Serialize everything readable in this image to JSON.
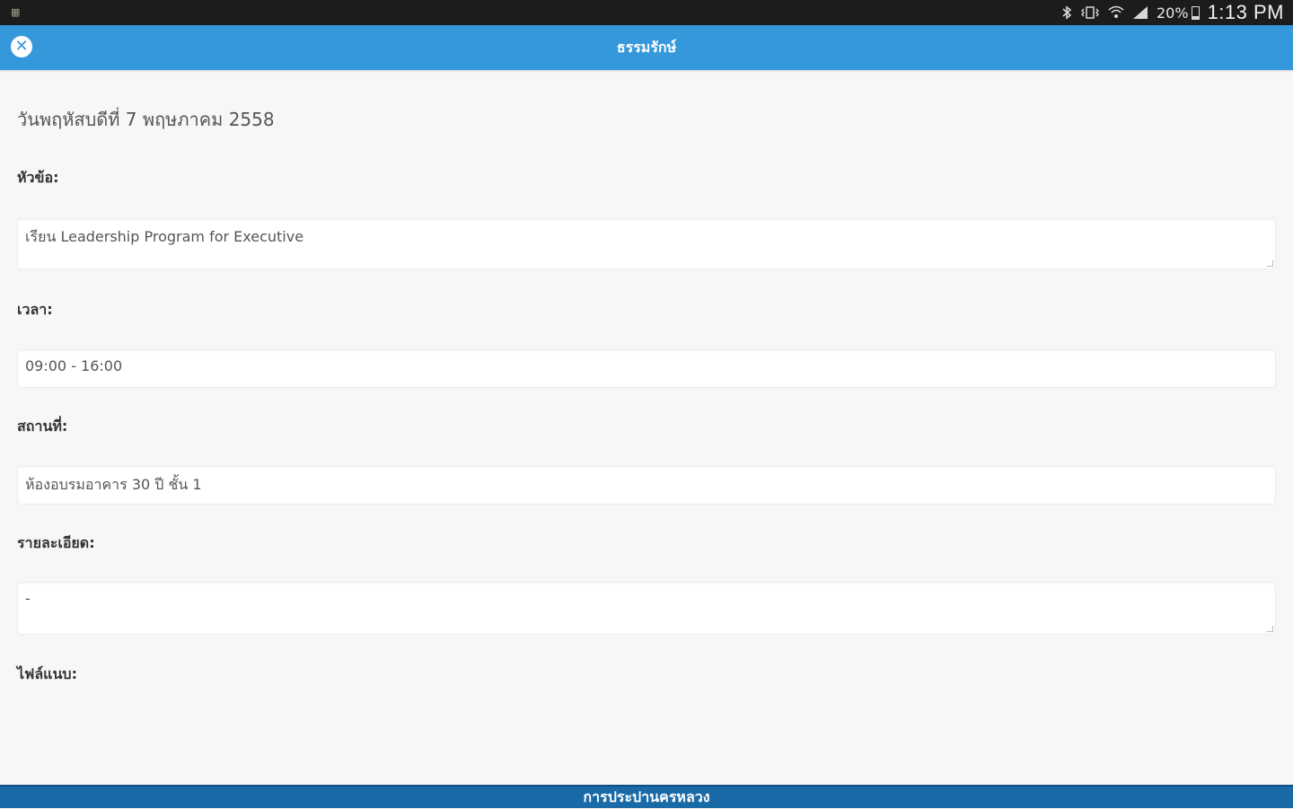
{
  "status_bar": {
    "app_icon": "notification-app-icon",
    "battery_percent": "20%",
    "battery_level": 0.2,
    "time": "1:13 PM",
    "icons": [
      "bluetooth-icon",
      "vibrate-icon",
      "wifi-icon",
      "signal-icon",
      "battery-icon"
    ]
  },
  "header": {
    "title": "ธรรมรักษ์",
    "close_icon": "close-icon",
    "color": "#3498db"
  },
  "content": {
    "date": "วันพฤหัสบดีที่ 7 พฤษภาคม 2558",
    "fields": [
      {
        "label": "หัวข้อ:",
        "value": "เรียน Leadership Program for Executive"
      },
      {
        "label": "เวลา:",
        "value": "09:00 - 16:00"
      },
      {
        "label": "สถานที่:",
        "value": "ห้องอบรมอาคาร 30 ปี ชั้น 1"
      },
      {
        "label": "รายละเอียด:",
        "value": "-"
      },
      {
        "label": "ไฟล์แนบ:",
        "value": ""
      }
    ]
  },
  "footer": {
    "text": "การประปานครหลวง",
    "color": "#1a6aa8"
  }
}
